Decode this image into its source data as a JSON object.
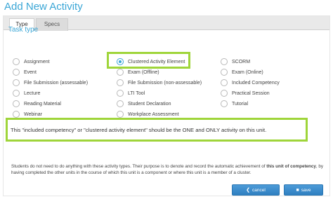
{
  "page": {
    "title": "Add New Activity"
  },
  "tabs": [
    {
      "label": "Type",
      "active": true
    },
    {
      "label": "Specs",
      "active": false
    }
  ],
  "section": {
    "label": "Task type"
  },
  "task_types": {
    "col1": [
      "Assignment",
      "Event",
      "File Submission (assessable)",
      "Lecture",
      "Reading Material",
      "Webinar"
    ],
    "col2": [
      "Clustered Activity Element",
      "Exam (Offline)",
      "File Submission (non-assessable)",
      "LTI Tool",
      "Student Declaration",
      "Workplace Assessment"
    ],
    "col3": [
      "SCORM",
      "Exam (Online)",
      "Included Competency",
      "Practical Session",
      "Tutorial"
    ],
    "selected": "Clustered Activity Element"
  },
  "note": {
    "text": "This \"included competency\" or \"clustered activity element\" should be the ONE and ONLY activity on this unit."
  },
  "description": {
    "part1": "Students do not need to do anything with these activity types. Their purpose is to denote and record the automatic achievement of ",
    "bold": "this unit of competency",
    "part2": ", by having completed the other units in the course of which this unit is a component or where this unit is a member of a cluster."
  },
  "buttons": {
    "cancel_label": "cancel",
    "save_label": "save",
    "cancel_icon": "arrow-left-icon",
    "save_icon": "save-icon"
  },
  "colors": {
    "accent": "#3aa6d6",
    "highlight": "#9fd53a",
    "button": "#2f7fc0"
  }
}
